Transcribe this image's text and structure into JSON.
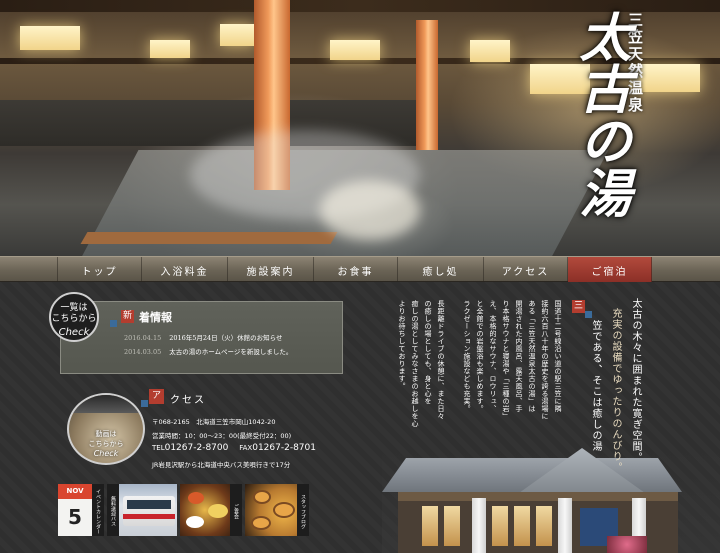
{
  "hero": {
    "subtitle": "三笠天然温泉",
    "logo": "太古の湯"
  },
  "nav": {
    "items": [
      {
        "label": "トップ"
      },
      {
        "label": "入浴料金"
      },
      {
        "label": "施設案内"
      },
      {
        "label": "お食事"
      },
      {
        "label": "癒し処"
      },
      {
        "label": "アクセス"
      },
      {
        "label": "ご宿泊"
      }
    ]
  },
  "check_badge": {
    "line1": "一覧は",
    "line2": "こちらから",
    "check": "Check"
  },
  "news": {
    "mark": "新",
    "title": "着情報",
    "rows": [
      {
        "date": "2016.04.15",
        "text": "2016年5月24日（火）休館のお知らせ"
      },
      {
        "date": "2014.03.05",
        "text": "太古の湯のホームページを新設しました。"
      }
    ]
  },
  "access": {
    "photo_label1": "動画は",
    "photo_label2": "こちらから",
    "photo_check": "Check",
    "mark": "ア",
    "title": "クセス",
    "postal": "〒068-2165　北海道三笠市岡山1042-20",
    "hours": "営業時間：10：00〜23：00(最終受付22：00)",
    "tel_label": "TEL",
    "tel": "01267-2-8700",
    "fax_label": "FAX",
    "fax": "01267-2-8701",
    "transit": "JR岩見沢駅から北海道中央バス美唄行きで17分"
  },
  "banners": {
    "cal_month": "NOV",
    "cal_day": "5",
    "cal_tab": "イベントカレンダー",
    "bus_tab": "無料送迎バス",
    "food_tab": "ご宴会",
    "bath_tab": "スタッフブログ"
  },
  "intro": {
    "lead1": "太古の木々に囲まれた寛ぎ空間。",
    "lead2": "充実の設備でゆったりのんびり。",
    "mark": "三",
    "lead3": "笠である、そこは癒しの湯",
    "para": [
      "国道十二号線沿い道の駅三笠に隣",
      "接約六百八十年の歴史を誇る湯場に",
      "ある「三笠天然温泉太古の湯」は",
      "開湯された内風呂、露天風呂、手",
      "り本格サウナと寝湯や「三種の岩」",
      "え、本格的なサウナ、ロウリュ、",
      "と全館での岩盤浴も楽しめます。",
      "ラクゼーション施設なども充実。",
      "",
      "長距離ドライブの休憩に、また日々",
      "の癒しの場としても、身と心を",
      "癒しの湯としてみなさまのお越しを心",
      "よりお待ちしております。"
    ]
  }
}
